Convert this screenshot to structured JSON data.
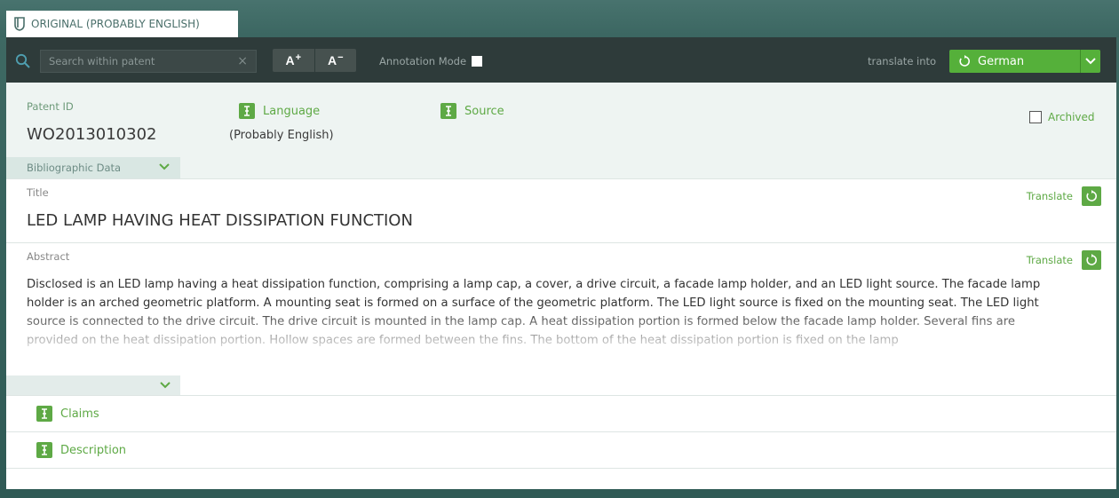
{
  "tab": {
    "label": "ORIGINAL (PROBABLY ENGLISH)"
  },
  "toolbar": {
    "search_placeholder": "Search within patent",
    "clear_symbol": "×",
    "font_increase": "A",
    "font_increase_sup": "+",
    "font_decrease": "A",
    "font_decrease_sup": "−",
    "annotation_mode": "Annotation Mode",
    "translate_into": "translate into",
    "language": "German"
  },
  "biblio": {
    "patent_id_label": "Patent ID",
    "patent_id": "WO2013010302",
    "language_label": "Language",
    "language_value": "(Probably English)",
    "source_label": "Source",
    "archived_label": "Archived",
    "tab_label": "Bibliographic Data"
  },
  "title_section": {
    "label": "Title",
    "translate": "Translate",
    "text": "LED LAMP HAVING HEAT DISSIPATION FUNCTION"
  },
  "abstract_section": {
    "label": "Abstract",
    "translate": "Translate",
    "text": "Disclosed is an LED lamp having a heat dissipation function, comprising a lamp cap, a cover, a drive circuit, a facade lamp holder, and an LED light source. The facade lamp holder is an arched geometric platform. A mounting seat is formed on a surface of the geometric platform. The LED light source is fixed on the mounting seat. The LED light source is connected to the drive circuit. The drive circuit is mounted in the lamp cap. A heat dissipation portion is formed below the facade lamp holder. Several fins are provided on the heat dissipation portion. Hollow spaces are formed between the fins. The bottom of the heat dissipation portion is fixed on the lamp"
  },
  "sections": {
    "claims": "Claims",
    "description": "Description"
  },
  "colors": {
    "accent_green": "#5ea945",
    "toolbar_bg": "#2e3b3a",
    "frame_teal": "#3f6a64"
  }
}
